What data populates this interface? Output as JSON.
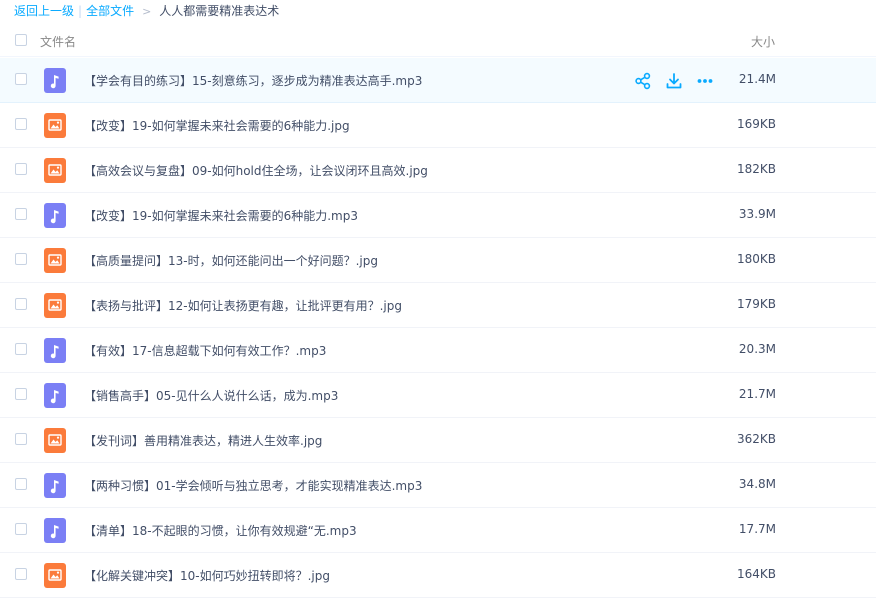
{
  "breadcrumb": {
    "back": "返回上一级",
    "separator": "|",
    "all_files": "全部文件",
    "arrow": ">",
    "current": "人人都需要精准表达术"
  },
  "columns": {
    "name": "文件名",
    "size": "大小"
  },
  "colors": {
    "accent": "#09aaff",
    "audio_icon": "#7b7ff5",
    "image_icon": "#fb7b3b"
  },
  "row_actions": {
    "share": "share-icon",
    "download": "download-icon",
    "more": "more-icon"
  },
  "files": [
    {
      "name": "【学会有目的练习】15-刻意练习，逐步成为精准表达高手.mp3",
      "size": "21.4M",
      "type": "audio"
    },
    {
      "name": "【改变】19-如何掌握未来社会需要的6种能力.jpg",
      "size": "169KB",
      "type": "image"
    },
    {
      "name": "【高效会议与复盘】09-如何hold住全场，让会议闭环且高效.jpg",
      "size": "182KB",
      "type": "image"
    },
    {
      "name": "【改变】19-如何掌握未来社会需要的6种能力.mp3",
      "size": "33.9M",
      "type": "audio"
    },
    {
      "name": "【高质量提问】13-时，如何还能问出一个好问题？.jpg",
      "size": "180KB",
      "type": "image"
    },
    {
      "name": "【表扬与批评】12-如何让表扬更有趣，让批评更有用？.jpg",
      "size": "179KB",
      "type": "image"
    },
    {
      "name": "【有效】17-信息超载下如何有效工作？.mp3",
      "size": "20.3M",
      "type": "audio"
    },
    {
      "name": "【销售高手】05-见什么人说什么话，成为.mp3",
      "size": "21.7M",
      "type": "audio"
    },
    {
      "name": "【发刊词】善用精准表达，精进人生效率.jpg",
      "size": "362KB",
      "type": "image"
    },
    {
      "name": "【两种习惯】01-学会倾听与独立思考，才能实现精准表达.mp3",
      "size": "34.8M",
      "type": "audio"
    },
    {
      "name": "【清单】18-不起眼的习惯，让你有效规避“无.mp3",
      "size": "17.7M",
      "type": "audio"
    },
    {
      "name": "【化解关键冲突】10-如何巧妙扭转即将？.jpg",
      "size": "164KB",
      "type": "image"
    }
  ]
}
